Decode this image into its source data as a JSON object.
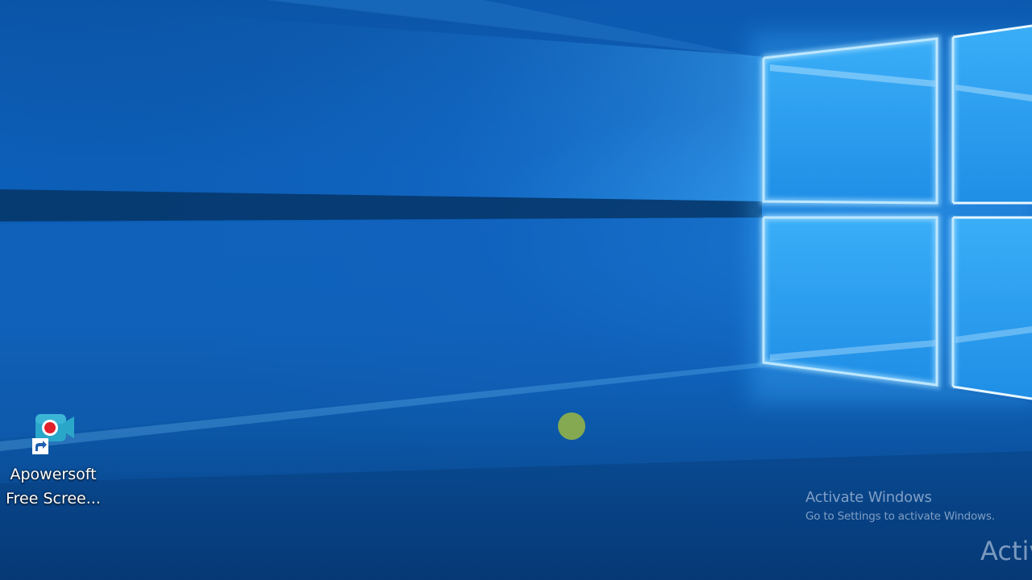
{
  "desktop": {
    "icons": [
      {
        "icon_name": "apowersoft-screen-recorder-icon",
        "label_line1": "Apowersoft",
        "label_line2": "Free Scree..."
      }
    ]
  },
  "watermark": {
    "title": "Activate Windows",
    "subtitle": "Go to Settings to activate Windows.",
    "echo_text": "Activ"
  },
  "colors": {
    "wallpaper_blue": "#0b5db4",
    "window_light": "#33a8f5",
    "cursor_highlight": "#8fb04a",
    "recorder_teal": "#2aa6c9",
    "record_red": "#e2202a"
  }
}
